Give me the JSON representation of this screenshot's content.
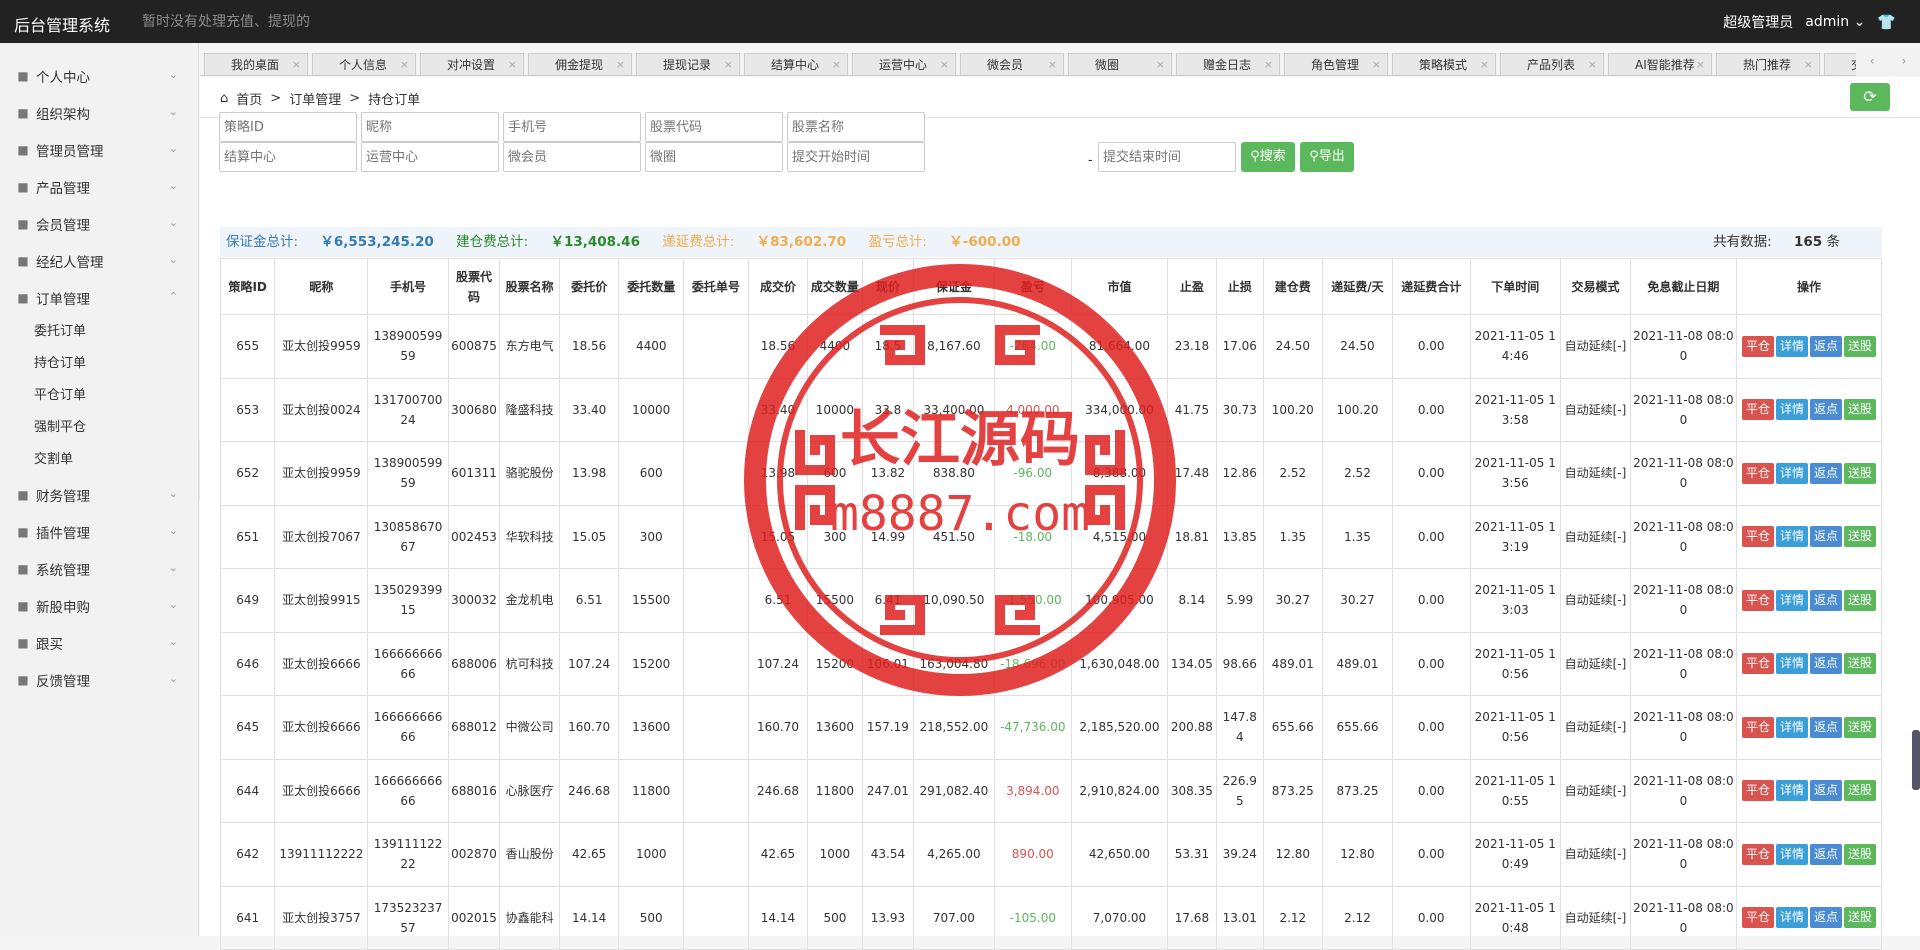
{
  "topbar": {
    "brand": "后台管理系统",
    "notice": "暂时没有处理充值、提现的",
    "role": "超级管理员",
    "user": "admin"
  },
  "sidebar": {
    "items": [
      {
        "label": "个人中心",
        "icon": "user-icon"
      },
      {
        "label": "组织架构",
        "icon": "org-icon"
      },
      {
        "label": "管理员管理",
        "icon": "user-icon"
      },
      {
        "label": "产品管理",
        "icon": "briefcase-icon"
      },
      {
        "label": "会员管理",
        "icon": "user-icon"
      },
      {
        "label": "经纪人管理",
        "icon": "agent-icon"
      },
      {
        "label": "订单管理",
        "icon": "doc-icon"
      }
    ],
    "sub_items": [
      "委托订单",
      "持仓订单",
      "平仓订单",
      "强制平仓",
      "交割单"
    ],
    "items_after": [
      {
        "label": "财务管理",
        "icon": "finance-icon"
      },
      {
        "label": "插件管理",
        "icon": "plugin-icon"
      },
      {
        "label": "系统管理",
        "icon": "gear-icon"
      },
      {
        "label": "新股申购",
        "icon": "stock-icon"
      },
      {
        "label": "跟买",
        "icon": "doc-icon"
      },
      {
        "label": "反馈管理",
        "icon": "feedback-icon"
      }
    ]
  },
  "tabs": [
    "我的桌面",
    "个人信息",
    "对冲设置",
    "佣金提现",
    "提现记录",
    "结算中心",
    "运营中心",
    "微会员",
    "微圈",
    "赠金日志",
    "角色管理",
    "策略模式",
    "产品列表",
    "AI智能推荐",
    "热门推荐",
    "交易"
  ],
  "breadcrumb": {
    "home": "首页",
    "sep": ">",
    "level2": "订单管理",
    "level3": "持仓订单"
  },
  "filters": {
    "row1": [
      "策略ID",
      "昵称",
      "手机号",
      "股票代码",
      "股票名称"
    ],
    "row2": [
      "结算中心",
      "运营中心",
      "微会员",
      "微圈",
      "提交开始时间"
    ],
    "end_time": "提交结束时间",
    "dash": "-",
    "search": "搜索",
    "export": "导出"
  },
  "summary": {
    "margin_label": "保证金总计:",
    "margin_value": "￥6,553,245.20",
    "build_label": "建仓费总计:",
    "build_value": "￥13,408.46",
    "defer_label": "递延费总计:",
    "defer_value": "￥83,602.70",
    "pnl_label": "盈亏总计:",
    "pnl_value": "￥-600.00",
    "count_label": "共有数据:",
    "count_value": "165",
    "count_unit": "条"
  },
  "table": {
    "headers": [
      "策略ID",
      "昵称",
      "手机号",
      "股票代码",
      "股票名称",
      "委托价",
      "委托数量",
      "委托单号",
      "成交价",
      "成交数量",
      "现价",
      "保证金",
      "盈亏",
      "市值",
      "止盈",
      "止损",
      "建仓费",
      "递延费/天",
      "递延费合计",
      "下单时间",
      "交易模式",
      "免息截止日期",
      "操作"
    ],
    "rows": [
      [
        "655",
        "亚太创投9959",
        "13890059959",
        "600875",
        "东方电气",
        "18.56",
        "4400",
        "",
        "18.56",
        "4400",
        "18.5",
        "8,167.60",
        "-264.00",
        "81,664.00",
        "23.18",
        "17.06",
        "24.50",
        "24.50",
        "0.00",
        "2021-11-05 14:46",
        "自动延续[-]",
        "2021-11-08 08:00"
      ],
      [
        "653",
        "亚太创投0024",
        "13170070024",
        "300680",
        "隆盛科技",
        "33.40",
        "10000",
        "",
        "33.40",
        "10000",
        "33.8",
        "33,400.00",
        "4,000.00",
        "334,000.00",
        "41.75",
        "30.73",
        "100.20",
        "100.20",
        "0.00",
        "2021-11-05 13:58",
        "自动延续[-]",
        "2021-11-08 08:00"
      ],
      [
        "652",
        "亚太创投9959",
        "13890059959",
        "601311",
        "骆驼股份",
        "13.98",
        "600",
        "",
        "13.98",
        "600",
        "13.82",
        "838.80",
        "-96.00",
        "8,388.00",
        "17.48",
        "12.86",
        "2.52",
        "2.52",
        "0.00",
        "2021-11-05 13:56",
        "自动延续[-]",
        "2021-11-08 08:00"
      ],
      [
        "651",
        "亚太创投7067",
        "13085867067",
        "002453",
        "华软科技",
        "15.05",
        "300",
        "",
        "15.05",
        "300",
        "14.99",
        "451.50",
        "-18.00",
        "4,515.00",
        "18.81",
        "13.85",
        "1.35",
        "1.35",
        "0.00",
        "2021-11-05 13:19",
        "自动延续[-]",
        "2021-11-08 08:00"
      ],
      [
        "649",
        "亚太创投9915",
        "13502939915",
        "300032",
        "金龙机电",
        "6.51",
        "15500",
        "",
        "6.51",
        "15500",
        "6.41",
        "10,090.50",
        "-1,550.00",
        "100,905.00",
        "8.14",
        "5.99",
        "30.27",
        "30.27",
        "0.00",
        "2021-11-05 13:03",
        "自动延续[-]",
        "2021-11-08 08:00"
      ],
      [
        "646",
        "亚太创投6666",
        "16666666666",
        "688006",
        "杭可科技",
        "107.24",
        "15200",
        "",
        "107.24",
        "15200",
        "106.01",
        "163,004.80",
        "-18,696.00",
        "1,630,048.00",
        "134.05",
        "98.66",
        "489.01",
        "489.01",
        "0.00",
        "2021-11-05 10:56",
        "自动延续[-]",
        "2021-11-08 08:00"
      ],
      [
        "645",
        "亚太创投6666",
        "16666666666",
        "688012",
        "中微公司",
        "160.70",
        "13600",
        "",
        "160.70",
        "13600",
        "157.19",
        "218,552.00",
        "-47,736.00",
        "2,185,520.00",
        "200.88",
        "147.84",
        "655.66",
        "655.66",
        "0.00",
        "2021-11-05 10:56",
        "自动延续[-]",
        "2021-11-08 08:00"
      ],
      [
        "644",
        "亚太创投6666",
        "16666666666",
        "688016",
        "心脉医疗",
        "246.68",
        "11800",
        "",
        "246.68",
        "11800",
        "247.01",
        "291,082.40",
        "3,894.00",
        "2,910,824.00",
        "308.35",
        "226.95",
        "873.25",
        "873.25",
        "0.00",
        "2021-11-05 10:55",
        "自动延续[-]",
        "2021-11-08 08:00"
      ],
      [
        "642",
        "13911112222",
        "13911112222",
        "002870",
        "香山股份",
        "42.65",
        "1000",
        "",
        "42.65",
        "1000",
        "43.54",
        "4,265.00",
        "890.00",
        "42,650.00",
        "53.31",
        "39.24",
        "12.80",
        "12.80",
        "0.00",
        "2021-11-05 10:49",
        "自动延续[-]",
        "2021-11-08 08:00"
      ],
      [
        "641",
        "亚太创投3757",
        "17352323757",
        "002015",
        "协鑫能科",
        "14.14",
        "500",
        "",
        "14.14",
        "500",
        "13.93",
        "707.00",
        "-105.00",
        "7,070.00",
        "17.68",
        "13.01",
        "2.12",
        "2.12",
        "0.00",
        "2021-11-05 10:48",
        "自动延续[-]",
        "2021-11-08 08:00"
      ]
    ],
    "ops": [
      "平仓",
      "详情",
      "返点",
      "送股"
    ]
  },
  "watermark": {
    "line1": "长江源码",
    "line2": "m8887.com"
  },
  "colors": {
    "green": "#5cb85c",
    "red": "#d9534f",
    "blue": "#3a9fd8",
    "topbar": "#222222"
  }
}
